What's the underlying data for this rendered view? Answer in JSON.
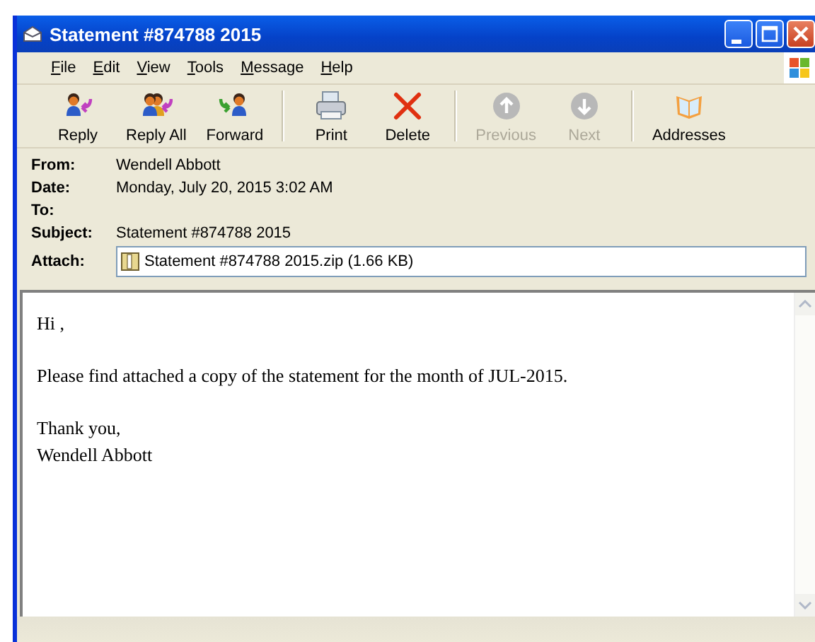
{
  "window": {
    "title": "Statement #874788 2015"
  },
  "menu": [
    {
      "label": "File"
    },
    {
      "label": "Edit"
    },
    {
      "label": "View"
    },
    {
      "label": "Tools"
    },
    {
      "label": "Message"
    },
    {
      "label": "Help"
    }
  ],
  "toolbar": [
    {
      "label": "Reply",
      "kind": "reply",
      "disabled": false
    },
    {
      "label": "Reply All",
      "kind": "replyall",
      "disabled": false
    },
    {
      "label": "Forward",
      "kind": "forward",
      "disabled": false
    },
    {
      "label": "Print",
      "kind": "print",
      "disabled": false
    },
    {
      "label": "Delete",
      "kind": "delete",
      "disabled": false
    },
    {
      "label": "Previous",
      "kind": "previous",
      "disabled": true
    },
    {
      "label": "Next",
      "kind": "next",
      "disabled": true
    },
    {
      "label": "Addresses",
      "kind": "addresses",
      "disabled": false
    }
  ],
  "headers": [
    {
      "label": "From:",
      "value": "Wendell Abbott",
      "kind": "text"
    },
    {
      "label": "Date:",
      "value": "Monday, July 20, 2015 3:02 AM",
      "kind": "text"
    },
    {
      "label": "To:",
      "kind": "text"
    },
    {
      "label": "Subject:",
      "value": "Statement #874788 2015",
      "kind": "text"
    },
    {
      "label": "Attach:",
      "value": "Statement #874788 2015.zip (1.66 KB)",
      "kind": "attachment"
    }
  ],
  "body": [
    {
      "lines": [
        "Hi ,"
      ]
    },
    {
      "lines": [
        "Please find attached a copy of the statement for the month of JUL-2015."
      ]
    },
    {
      "lines": [
        "Thank you,",
        "Wendell Abbott"
      ]
    }
  ]
}
